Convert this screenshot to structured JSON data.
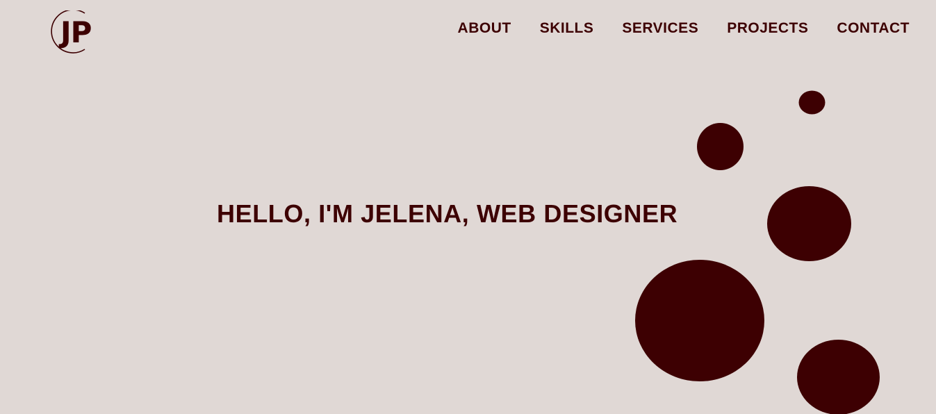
{
  "logo": {
    "text": "JP"
  },
  "nav": {
    "items": [
      {
        "label": "ABOUT"
      },
      {
        "label": "SKILLS"
      },
      {
        "label": "SERVICES"
      },
      {
        "label": "PROJECTS"
      },
      {
        "label": "CONTACT"
      }
    ]
  },
  "hero": {
    "title": "HELLO, I'M JELENA, WEB DESIGNER"
  },
  "theme": {
    "background": "#e0d8d5",
    "accent": "#3d0002"
  }
}
